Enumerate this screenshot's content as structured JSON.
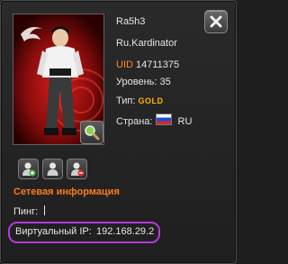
{
  "profile": {
    "nickname": "Ra5h3",
    "clan": "Ru.Kardinator",
    "uid_label": "UID",
    "uid_value": "14711375",
    "level_label": "Уровень:",
    "level_value": "35",
    "type_label": "Тип:",
    "type_value": "GOLD",
    "country_label": "Страна:",
    "country_value": "RU"
  },
  "network": {
    "section_title": "Сетевая информация",
    "ping_label": "Пинг:",
    "ping_value": "",
    "virtual_ip_label": "Виртуальный IP:",
    "virtual_ip_value": "192.168.29.2"
  },
  "icons": {
    "close": "close-icon",
    "magnify": "magnifier-icon",
    "add_friend": "add-user-icon",
    "user": "user-icon",
    "remove_friend": "remove-user-icon"
  },
  "colors": {
    "accent_orange": "#ff7a1e",
    "gold": "#ffb400",
    "highlight_ring": "#b43ad8"
  }
}
